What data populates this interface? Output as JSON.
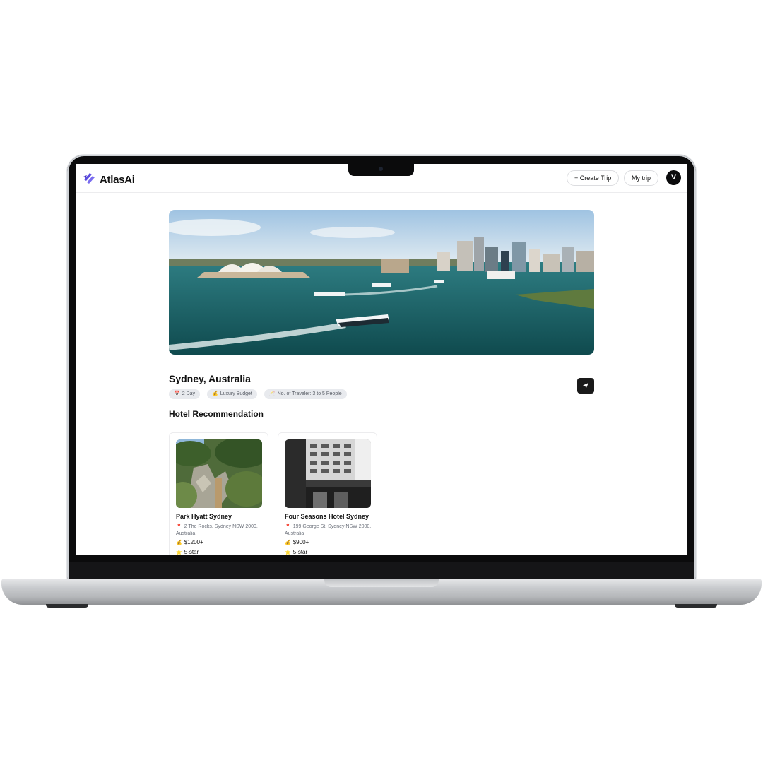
{
  "app": {
    "brand": "AtlasAi",
    "brand_color": "#5b4be0",
    "avatar_letter": "V"
  },
  "header": {
    "create_trip_label": "+ Create Trip",
    "my_trip_label": "My trip"
  },
  "trip": {
    "destination": "Sydney, Australia",
    "tags": [
      {
        "icon": "calendar-icon",
        "label": "2 Day"
      },
      {
        "icon": "money-bag-icon",
        "label": "Luxury Budget"
      },
      {
        "icon": "travelers-icon",
        "label": "No. of Traveler: 3 to 5 People"
      }
    ]
  },
  "hotels": {
    "section_title": "Hotel Recommendation",
    "items": [
      {
        "name": "Park Hyatt Sydney",
        "address": "2 The Rocks, Sydney NSW 2000, Australia",
        "price": "$1200+",
        "rating": "5-star"
      },
      {
        "name": "Four Seasons Hotel Sydney",
        "address": "199 George St, Sydney NSW 2000, Australia",
        "price": "$900+",
        "rating": "5-star"
      }
    ]
  }
}
